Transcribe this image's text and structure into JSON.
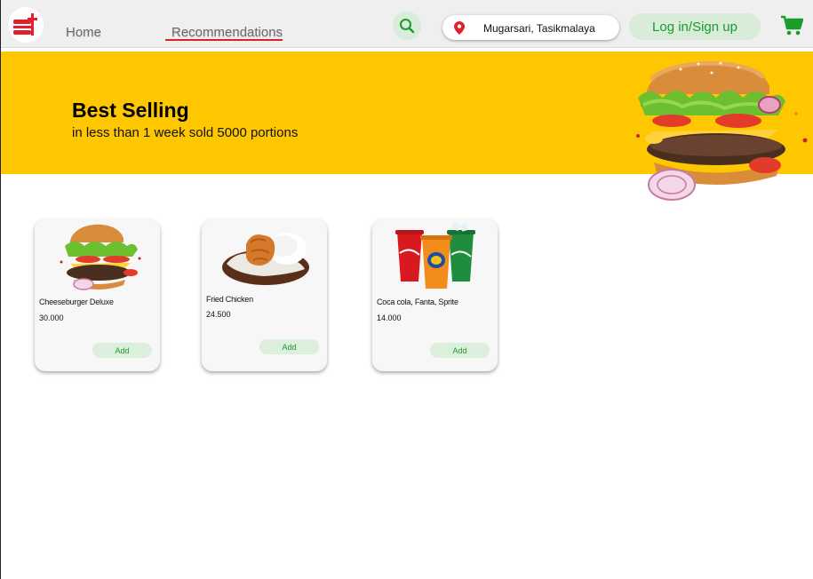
{
  "nav": {
    "home_label": "Home",
    "recommendations_label": "Recommendations",
    "active": "Recommendations"
  },
  "search": {
    "icon": "search-icon"
  },
  "location": {
    "value": "Mugarsari, Tasikmalaya",
    "icon": "location-pin-icon"
  },
  "auth": {
    "login_label": "Log in/Sign up"
  },
  "cart": {
    "icon": "cart-icon"
  },
  "banner": {
    "title": "Best Selling",
    "subtitle": "in less than 1 week sold 5000 portions",
    "image": "burger-hero-image"
  },
  "products": [
    {
      "name": "Cheeseburger Deluxe",
      "price": "30.000",
      "add_label": "Add",
      "image": "cheeseburger-image"
    },
    {
      "name": "Fried Chicken",
      "price": "24.500",
      "add_label": "Add",
      "image": "fried-chicken-image"
    },
    {
      "name": "Coca cola, Fanta, Sprite",
      "price": "14.000",
      "add_label": "Add",
      "image": "soft-drinks-image"
    }
  ],
  "colors": {
    "brand_red": "#e0202a",
    "accent_green": "#1a9c2b",
    "banner_yellow": "#ffc700",
    "button_green_bg": "#d9ebd9",
    "topbar_bg": "#efefef"
  }
}
